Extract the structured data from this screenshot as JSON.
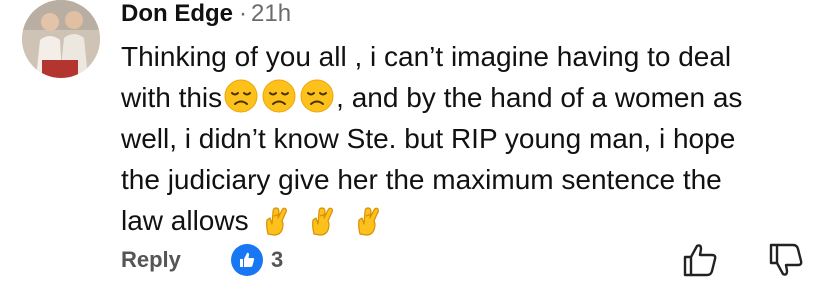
{
  "comment": {
    "author": "Don Edge",
    "separator": "·",
    "time": "21h",
    "text": {
      "line1": "Thinking of you all , i can’t imagine having to deal",
      "line2_start": "with this",
      "line2_end": ", and by the hand of a women as",
      "line3": "well, i didn’t know Ste. but RIP young man, i hope",
      "line4": "the judiciary give her the maximum sentence the",
      "line5": "law allows"
    },
    "emojis": {
      "line2": [
        "disappointed-face",
        "disappointed-face",
        "disappointed-face"
      ],
      "line5": [
        "crossed-fingers",
        "crossed-fingers",
        "crossed-fingers"
      ]
    }
  },
  "actions": {
    "reply_label": "Reply",
    "like_count": "3",
    "like_color": "#1877f2",
    "upvote_icon": "thumbs-up-outline-icon",
    "downvote_icon": "thumbs-down-outline-icon"
  }
}
